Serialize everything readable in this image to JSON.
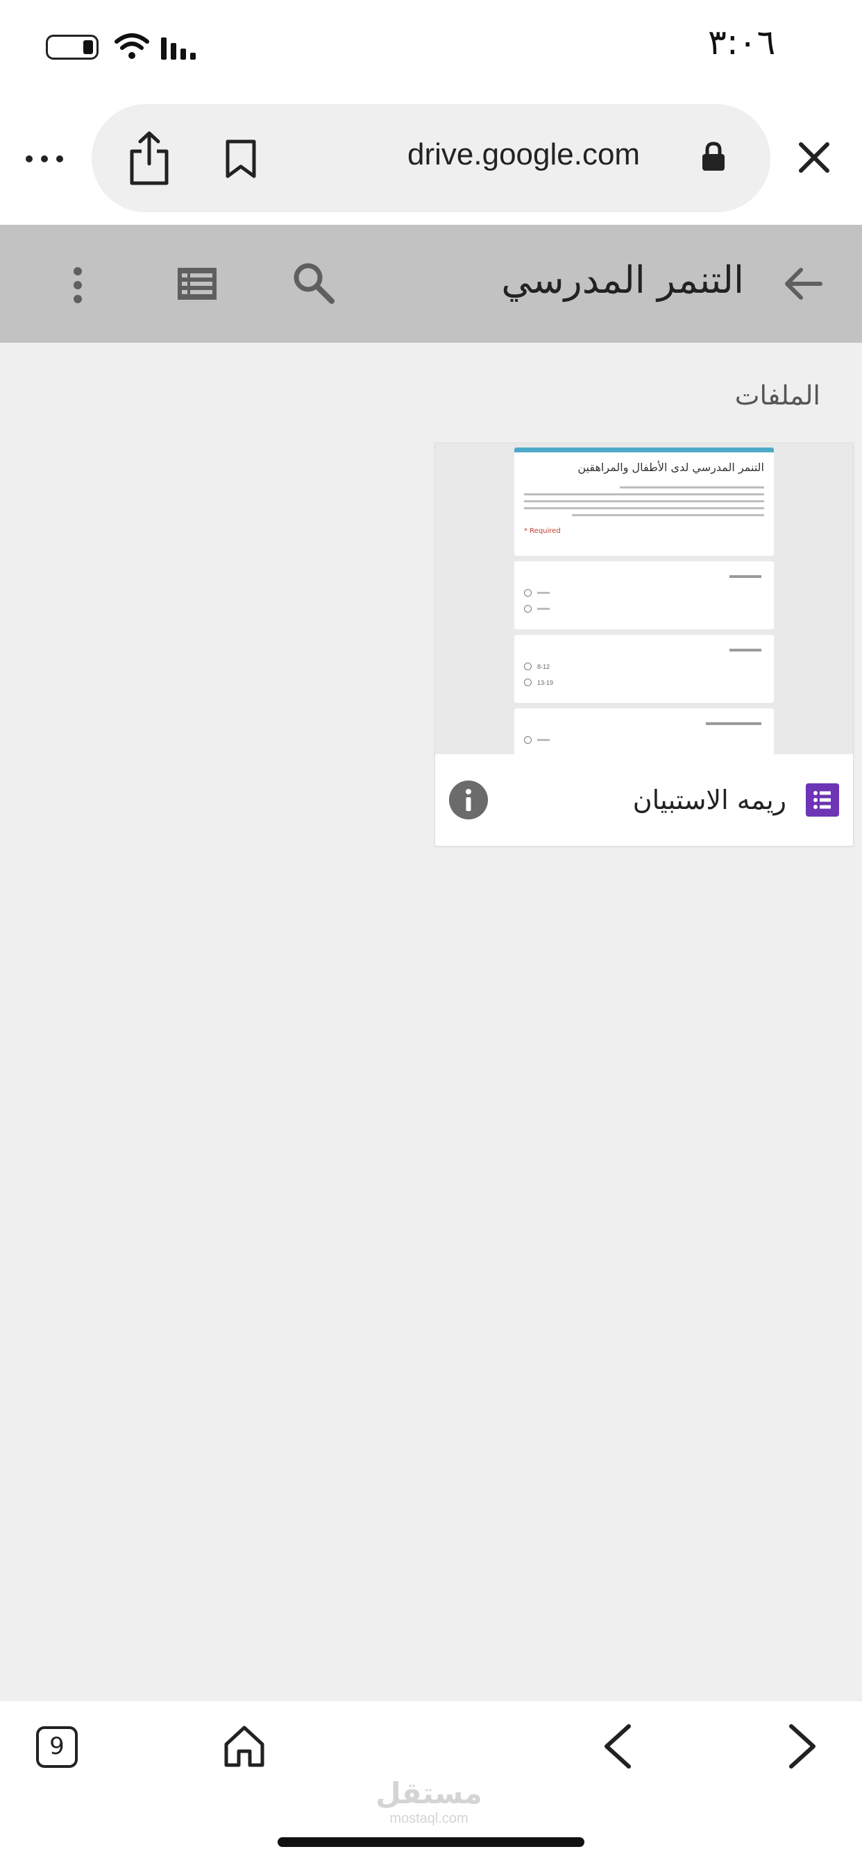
{
  "status_bar": {
    "time": "٣:٠٦"
  },
  "browser": {
    "url": "drive.google.com"
  },
  "app_bar": {
    "title": "التنمر المدرسي"
  },
  "content": {
    "section_label": "الملفات",
    "file": {
      "name": "ريمه الاستبيان",
      "thumbnail": {
        "form_title": "التنمر المدرسي لدى الأطفال والمراهقين",
        "required_text": "* Required",
        "q2_options": [
          "8-12",
          "13-19"
        ]
      }
    }
  },
  "bottom_bar": {
    "tab_count": "9"
  },
  "watermark": {
    "logo": "مستقل",
    "text": "mostaql.com"
  },
  "colors": {
    "app_bar": "#c2c2c2",
    "forms_icon": "#6d34b5",
    "form_accent": "#4fa8c8",
    "background": "#efefef"
  }
}
